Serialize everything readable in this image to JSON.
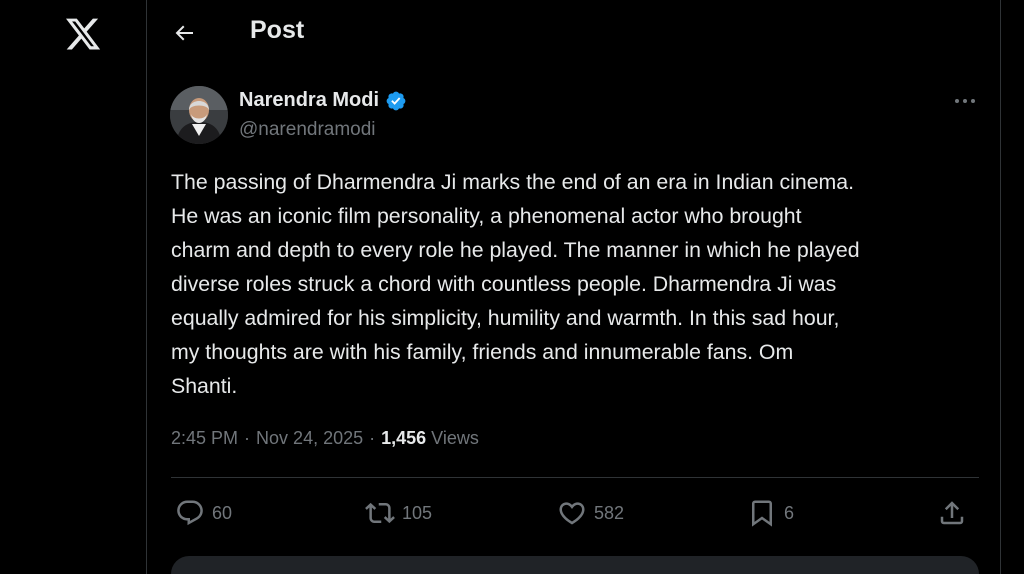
{
  "sidebar": {
    "logo_icon": "x-logo-icon"
  },
  "header": {
    "back_icon": "arrow-left-icon",
    "title": "Post"
  },
  "post": {
    "author": {
      "display_name": "Narendra Modi",
      "handle": "@narendramodi",
      "verified": true,
      "verified_color": "#1d9bf0"
    },
    "text": "The passing of Dharmendra Ji marks the end of an era in Indian cinema.\nHe was an iconic film personality, a phenomenal actor who brought\ncharm and depth to every role he played. The manner in which he played\ndiverse roles struck a chord with countless people. Dharmendra Ji was\nequally admired for his simplicity, humility and warmth. In this sad hour,\nmy thoughts are with his family, friends and innumerable fans. Om\nShanti.",
    "time": "2:45 PM",
    "separator": "·",
    "date": "Nov 24, 2025",
    "views_count": "1,456",
    "views_label": "Views",
    "actions": {
      "reply": {
        "icon": "reply-icon",
        "count": "60"
      },
      "repost": {
        "icon": "repost-icon",
        "count": "105"
      },
      "like": {
        "icon": "heart-icon",
        "count": "582"
      },
      "bookmark": {
        "icon": "bookmark-icon",
        "count": "6"
      },
      "share": {
        "icon": "share-icon"
      }
    }
  },
  "colors": {
    "background": "#000000",
    "text_primary": "#e7e9ea",
    "text_secondary": "#71767b",
    "border": "#2f3336"
  }
}
